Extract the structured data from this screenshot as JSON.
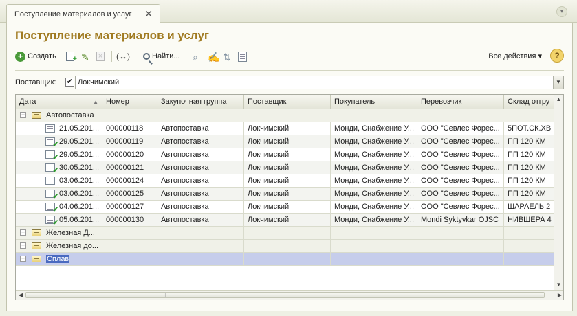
{
  "tab": {
    "label": "Поступление материалов и услуг",
    "close": "✕"
  },
  "form": {
    "title": "Поступление материалов и услуг"
  },
  "toolbar": {
    "create_label": "Создать",
    "find_label": "Найти...",
    "link_label": "(↔)",
    "all_actions_label": "Все действия ▾",
    "help_label": "?"
  },
  "filter": {
    "label": "Поставщик:",
    "checked": "✔",
    "value": "Локчимский"
  },
  "grid": {
    "columns": [
      "Дата",
      "Номер",
      "Закупочная группа",
      "Поставщик",
      "Покупатель",
      "Перевозчик",
      "Склад отгру"
    ],
    "groups": [
      {
        "name": "Автопоставка",
        "expanded": true,
        "rows": [
          {
            "date": "21.05.201...",
            "number": "000000118",
            "group": "Автопоставка",
            "supplier": "Локчимский",
            "buyer": "Монди, Снабжение У...",
            "carrier": "ООО \"Севлес Форес...",
            "warehouse": "5ПОТ.СК.ХВ",
            "posted": false
          },
          {
            "date": "29.05.201...",
            "number": "000000119",
            "group": "Автопоставка",
            "supplier": "Локчимский",
            "buyer": "Монди, Снабжение У...",
            "carrier": "ООО \"Севлес Форес...",
            "warehouse": "ПП 120 КМ",
            "posted": true
          },
          {
            "date": "29.05.201...",
            "number": "000000120",
            "group": "Автопоставка",
            "supplier": "Локчимский",
            "buyer": "Монди, Снабжение У...",
            "carrier": "ООО \"Севлес Форес...",
            "warehouse": "ПП 120 КМ",
            "posted": true
          },
          {
            "date": "30.05.201...",
            "number": "000000121",
            "group": "Автопоставка",
            "supplier": "Локчимский",
            "buyer": "Монди, Снабжение У...",
            "carrier": "ООО \"Севлес Форес...",
            "warehouse": "ПП 120 КМ",
            "posted": true
          },
          {
            "date": "03.06.201...",
            "number": "000000124",
            "group": "Автопоставка",
            "supplier": "Локчимский",
            "buyer": "Монди, Снабжение У...",
            "carrier": "ООО \"Севлес Форес...",
            "warehouse": "ПП 120 КМ",
            "posted": false
          },
          {
            "date": "03.06.201...",
            "number": "000000125",
            "group": "Автопоставка",
            "supplier": "Локчимский",
            "buyer": "Монди, Снабжение У...",
            "carrier": "ООО \"Севлес Форес...",
            "warehouse": "ПП 120 КМ",
            "posted": true
          },
          {
            "date": "04.06.201...",
            "number": "000000127",
            "group": "Автопоставка",
            "supplier": "Локчимский",
            "buyer": "Монди, Снабжение У...",
            "carrier": "ООО \"Севлес Форес...",
            "warehouse": "ШАРАЕЛЬ 2",
            "posted": true
          },
          {
            "date": "05.06.201...",
            "number": "000000130",
            "group": "Автопоставка",
            "supplier": "Локчимский",
            "buyer": "Монди, Снабжение У...",
            "carrier": "Mondi Syktyvkar OJSC",
            "warehouse": "НИВШЕРА 4",
            "posted": true
          }
        ]
      },
      {
        "name": "Железная Д...",
        "expanded": false,
        "rows": []
      },
      {
        "name": "Железная до...",
        "expanded": false,
        "rows": []
      },
      {
        "name": "Сплав",
        "expanded": false,
        "selected": true,
        "rows": []
      }
    ]
  },
  "colors": {
    "title": "#a07a20",
    "selection": "#c6cdeb",
    "accent": "#4a9a3a"
  }
}
